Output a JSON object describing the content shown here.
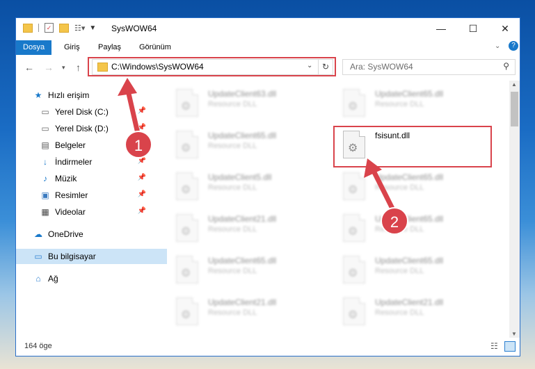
{
  "window": {
    "title": "SysWOW64",
    "controls": {
      "minimize": "—",
      "maximize": "☐",
      "close": "✕"
    }
  },
  "ribbon": {
    "tabs": [
      {
        "label": "Dosya",
        "active": true
      },
      {
        "label": "Giriş",
        "active": false
      },
      {
        "label": "Paylaş",
        "active": false
      },
      {
        "label": "Görünüm",
        "active": false
      }
    ]
  },
  "address": {
    "path": "C:\\Windows\\SysWOW64",
    "search_placeholder": "Ara: SysWOW64"
  },
  "sidebar": {
    "items": [
      {
        "label": "Hızlı erişim",
        "icon": "star-icon",
        "pinned": false
      },
      {
        "label": "Yerel Disk (C:)",
        "icon": "drive-icon",
        "pinned": true
      },
      {
        "label": "Yerel Disk (D:)",
        "icon": "drive-icon",
        "pinned": true
      },
      {
        "label": "Belgeler",
        "icon": "documents-icon",
        "pinned": true
      },
      {
        "label": "İndirmeler",
        "icon": "download-icon",
        "pinned": true
      },
      {
        "label": "Müzik",
        "icon": "music-icon",
        "pinned": true
      },
      {
        "label": "Resimler",
        "icon": "pictures-icon",
        "pinned": true
      },
      {
        "label": "Videolar",
        "icon": "videos-icon",
        "pinned": true
      },
      {
        "label": "OneDrive",
        "icon": "cloud-icon",
        "pinned": false
      },
      {
        "label": "Bu bilgisayar",
        "icon": "computer-icon",
        "pinned": false
      },
      {
        "label": "Ağ",
        "icon": "network-icon",
        "pinned": false
      }
    ]
  },
  "files": {
    "left_column": [
      {
        "name": "UpdateClient63.dll",
        "desc": "Resource DLL"
      },
      {
        "name": "UpdateClient65.dll",
        "desc": "Resource DLL"
      },
      {
        "name": "UpdateClient5.dll",
        "desc": "Resource DLL"
      },
      {
        "name": "UpdateClient21.dll",
        "desc": "Resource DLL"
      },
      {
        "name": "UpdateClient65.dll",
        "desc": "Resource DLL"
      },
      {
        "name": "UpdateClient21.dll",
        "desc": "Resource DLL"
      }
    ],
    "right_column": [
      {
        "name": "UpdateClient65.dll",
        "desc": "Resource DLL"
      },
      {
        "name": "fsisunt.dll",
        "desc": ""
      },
      {
        "name": "UpdateClient65.dll",
        "desc": "Resource DLL"
      },
      {
        "name": "UpdateClient65.dll",
        "desc": "Resource DLL"
      },
      {
        "name": "UpdateClient65.dll",
        "desc": "Resource DLL"
      },
      {
        "name": "UpdateClient21.dll",
        "desc": "Resource DLL"
      }
    ]
  },
  "status": {
    "count": "164 öge"
  },
  "annotations": {
    "badge1": "1",
    "badge2": "2",
    "color": "#d9434b"
  }
}
